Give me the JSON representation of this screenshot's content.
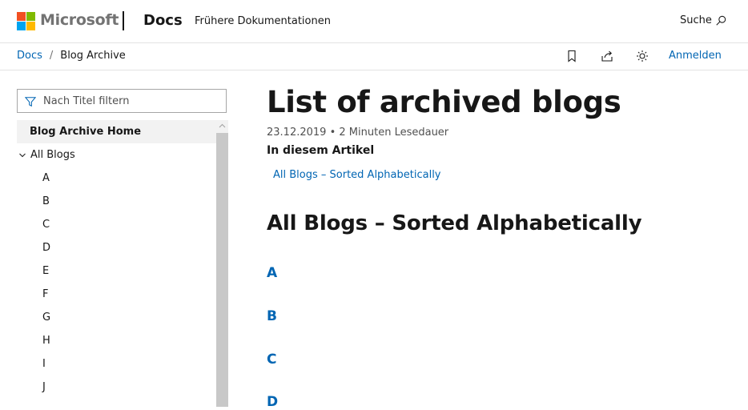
{
  "header": {
    "brand": "Microsoft",
    "site": "Docs",
    "previous_docs": "Frühere Dokumentationen",
    "search_label": "Suche",
    "logo_colors": [
      "#f25022",
      "#7fba00",
      "#00a4ef",
      "#ffb900"
    ]
  },
  "breadcrumb": {
    "items": [
      "Docs",
      "Blog Archive"
    ],
    "separator": "/"
  },
  "actions": {
    "icons": [
      "bookmark-icon",
      "share-icon",
      "theme-icon"
    ],
    "signin": "Anmelden"
  },
  "sidebar": {
    "filter_placeholder": "Nach Titel filtern",
    "home": "Blog Archive Home",
    "group": "All Blogs",
    "letters": [
      "A",
      "B",
      "C",
      "D",
      "E",
      "F",
      "G",
      "H",
      "I",
      "J"
    ]
  },
  "main": {
    "title": "List of archived blogs",
    "date": "23.12.2019",
    "bullet": "•",
    "read_time": "2 Minuten Lesedauer",
    "in_article": "In diesem Artikel",
    "in_article_link": "All Blogs – Sorted Alphabetically",
    "section_title": "All Blogs – Sorted Alphabetically",
    "letter_headings": [
      "A",
      "B",
      "C",
      "D"
    ]
  },
  "colors": {
    "link": "#0065b3",
    "text": "#171717",
    "border": "#e3e3e3"
  }
}
